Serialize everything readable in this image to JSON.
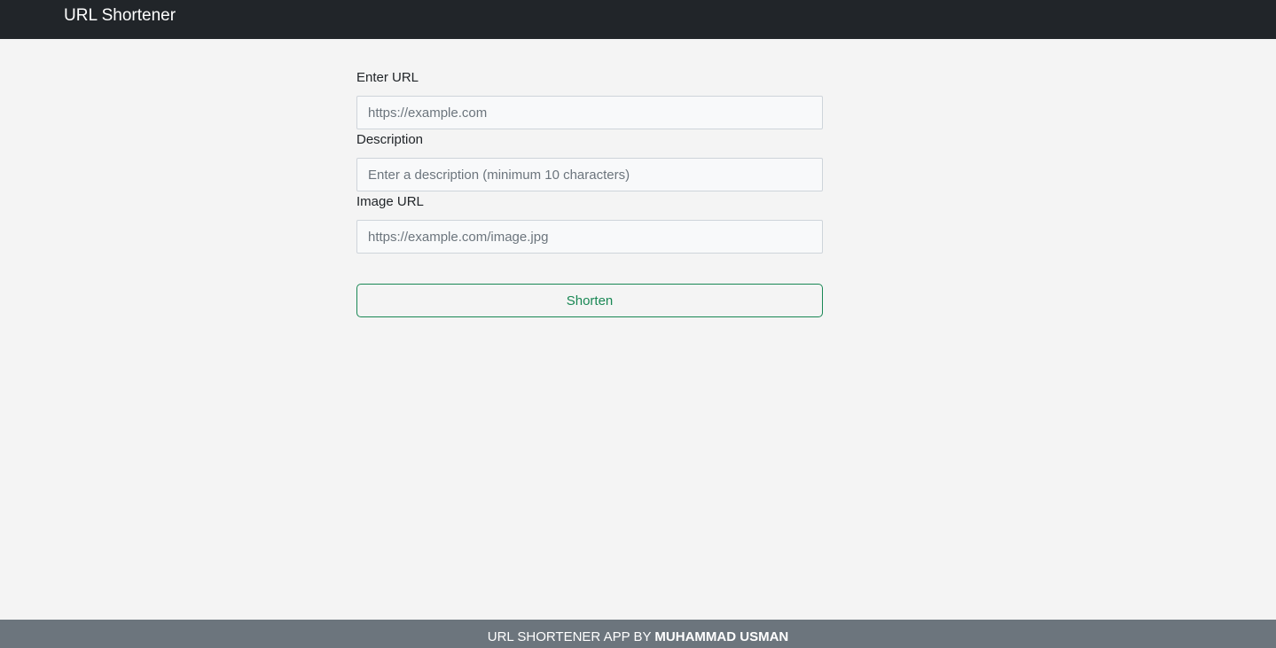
{
  "navbar": {
    "brand": "URL Shortener"
  },
  "form": {
    "url": {
      "label": "Enter URL",
      "placeholder": "https://example.com",
      "value": ""
    },
    "description": {
      "label": "Description",
      "placeholder": "Enter a description (minimum 10 characters)",
      "value": ""
    },
    "image": {
      "label": "Image URL",
      "placeholder": "https://example.com/image.jpg",
      "value": ""
    },
    "submit_label": "Shorten"
  },
  "footer": {
    "prefix": "URL Shortener App by",
    "author": "Muhammad Usman"
  },
  "colors": {
    "navbar_bg": "#212529",
    "page_bg": "#f4f4f4",
    "footer_bg": "#6c757d",
    "accent_success": "#198754"
  }
}
